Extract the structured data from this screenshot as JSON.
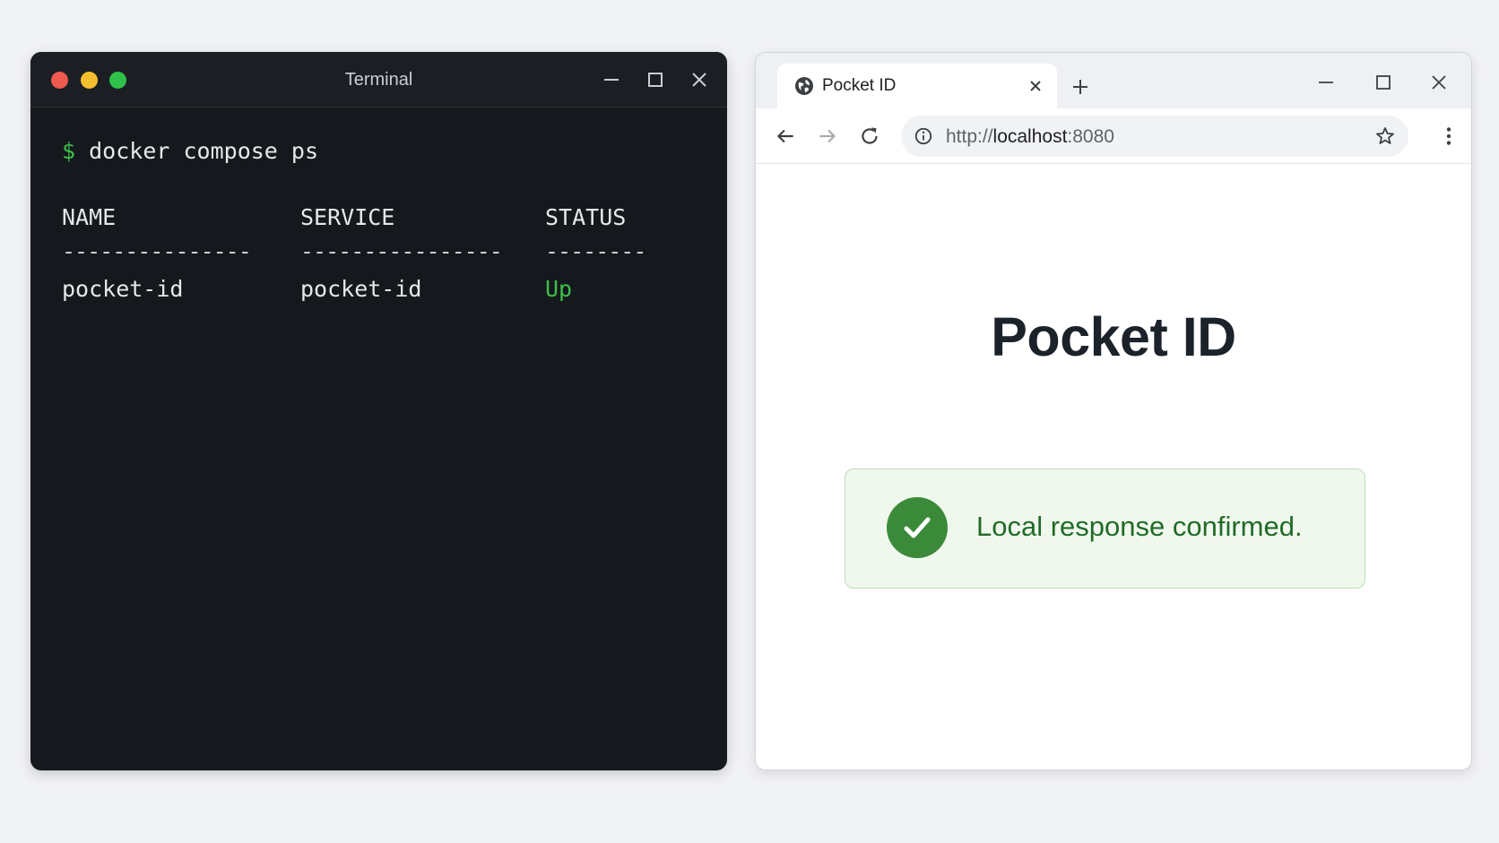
{
  "terminal": {
    "title": "Terminal",
    "prompt_symbol": "$",
    "command": "docker compose ps",
    "table": {
      "headers": [
        "NAME",
        "SERVICE",
        "STATUS"
      ],
      "dividers": [
        "---------------",
        "----------------",
        "--------"
      ],
      "rows": [
        {
          "name": "pocket-id",
          "service": "pocket-id",
          "status": "Up"
        }
      ]
    },
    "icons": {
      "minimize": "minimize-icon",
      "maximize": "maximize-icon",
      "close": "close-icon"
    }
  },
  "browser": {
    "tab": {
      "title": "Pocket ID",
      "icon": "globe-icon"
    },
    "address": {
      "scheme": "http://",
      "host": "localhost",
      "port": ":8080"
    },
    "page": {
      "title": "Pocket ID",
      "alert": {
        "message": "Local response confirmed.",
        "icon": "check-circle-icon"
      }
    }
  },
  "colors": {
    "terminal_bg": "#15191d",
    "prompt_green": "#3fbf4a",
    "alert_bg": "#f0f8ee",
    "alert_border": "#bfdcb9",
    "alert_text": "#216b27",
    "check_green": "#3a8a3a"
  }
}
